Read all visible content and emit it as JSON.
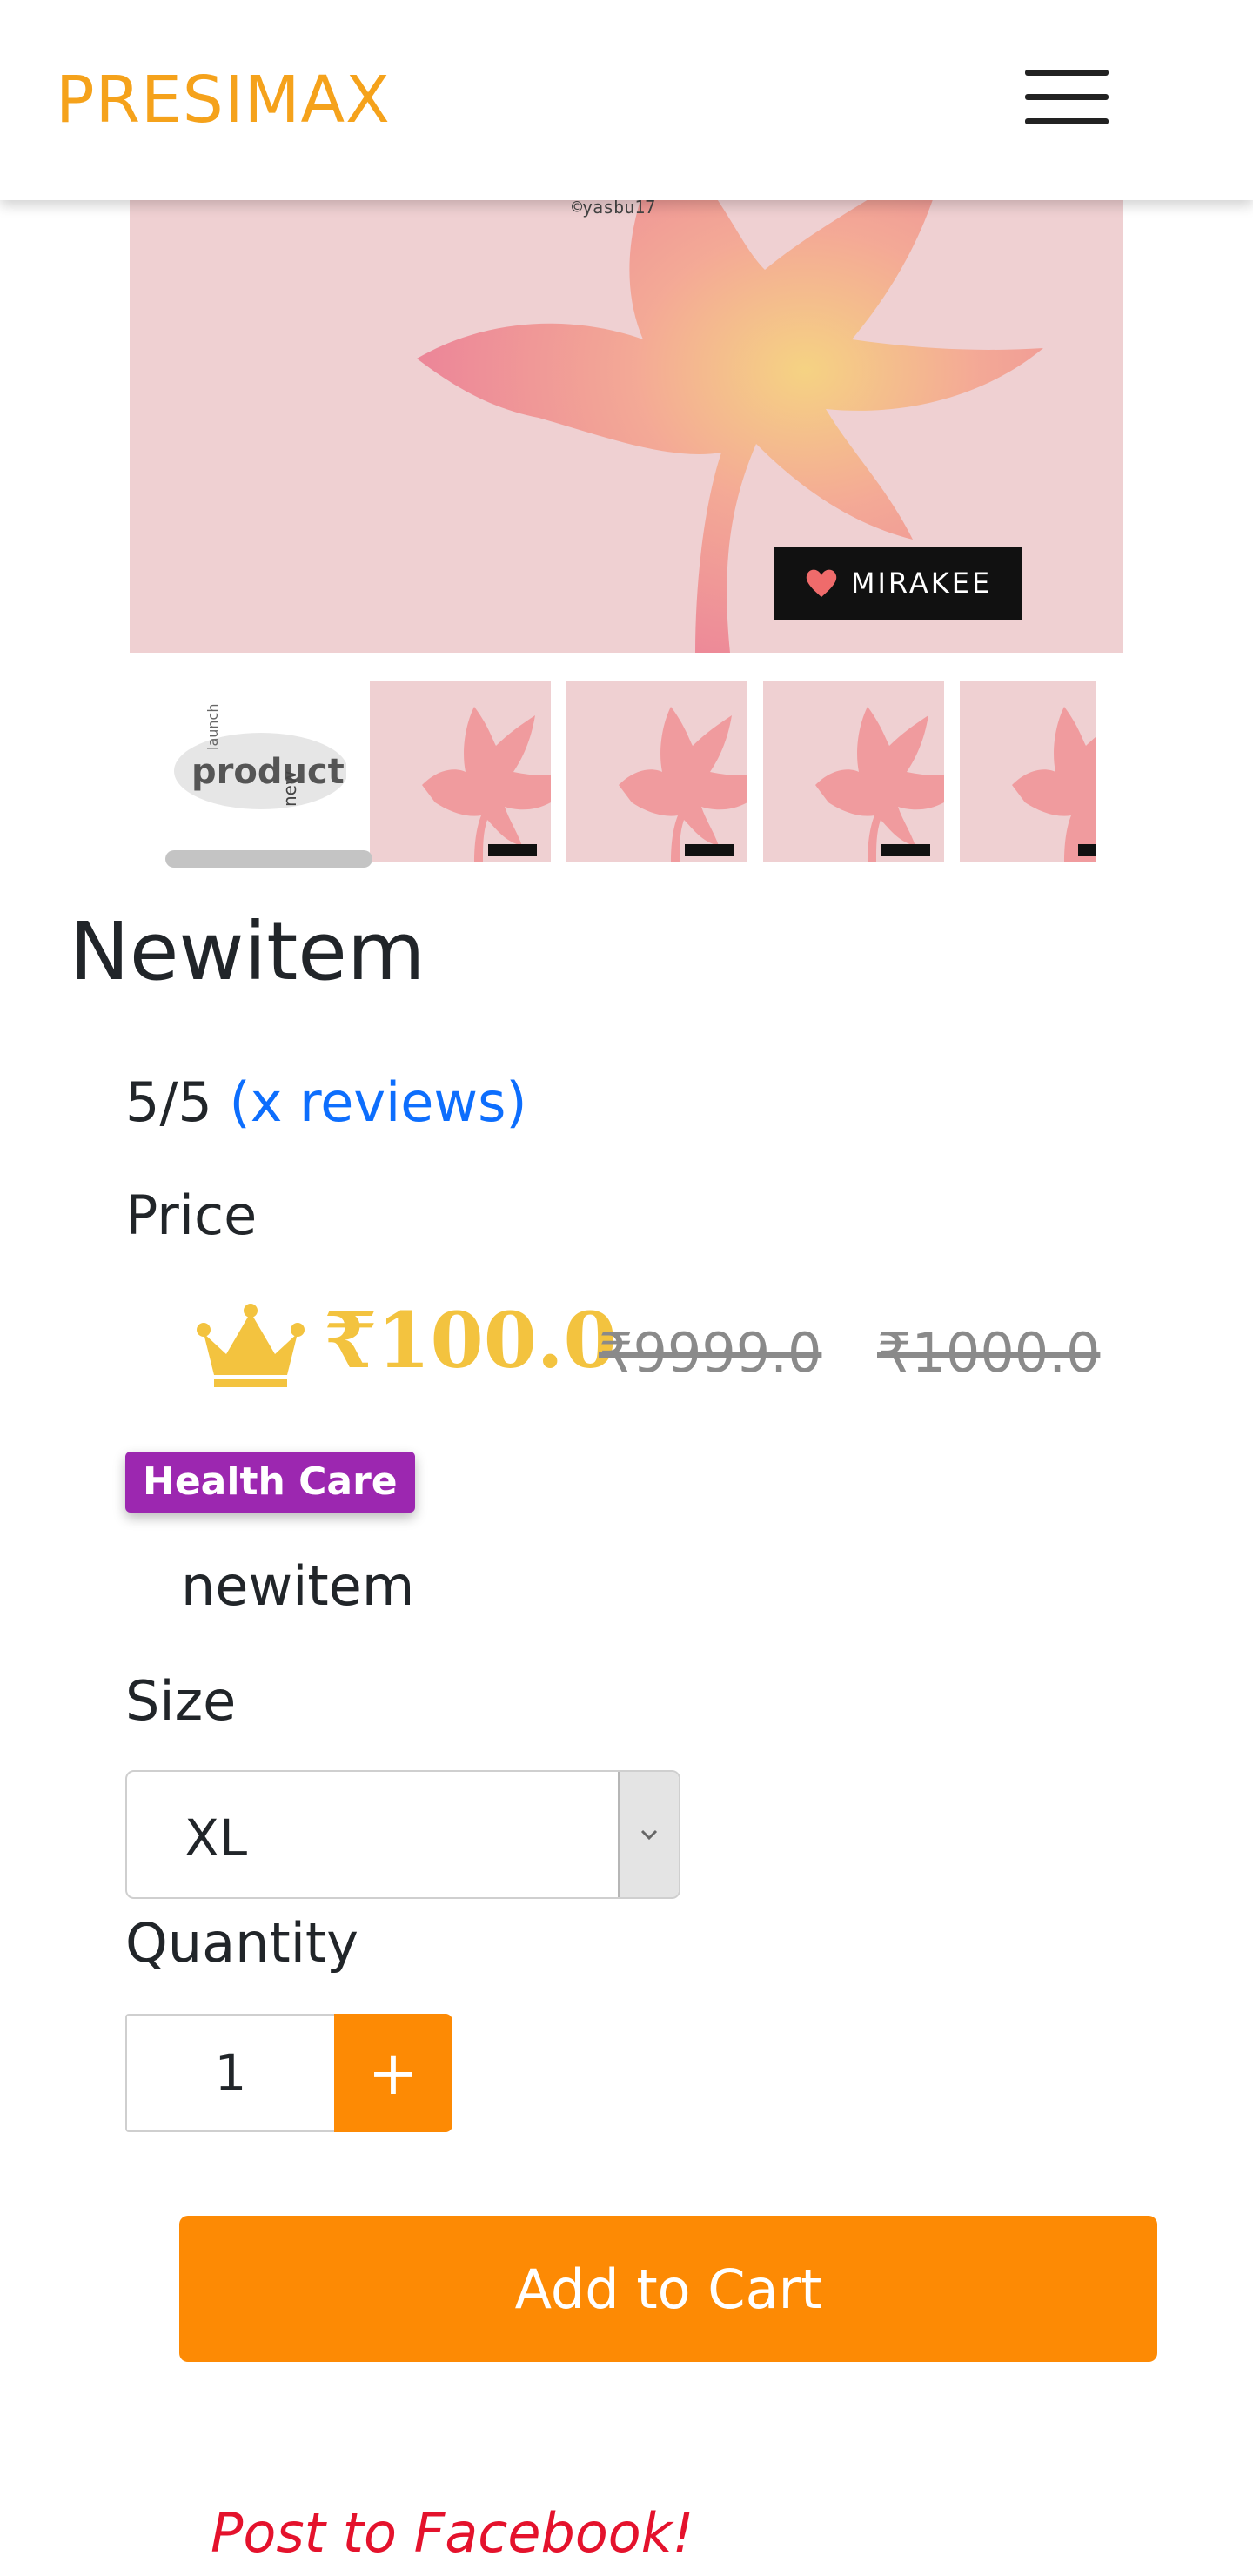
{
  "header": {
    "brand": "PRESIMAX",
    "menu_icon": "hamburger-menu-icon"
  },
  "gallery": {
    "main_image": {
      "watermark_handle": "©yasbu17",
      "badge_text": "MIRAKEE",
      "badge_icon": "heart-icon"
    },
    "thumbnail_1_words": [
      "product",
      "new",
      "launch"
    ],
    "thumbnail_count": 5,
    "thumbnail_scroll_position": 0
  },
  "product": {
    "title": "Newitem",
    "rating": "5/5",
    "reviews_link": "(x reviews)",
    "price_label": "Price",
    "price_icon": "crown-icon",
    "price": "₹100.0",
    "strikethrough_price_1": "₹9999.0",
    "strikethrough_price_2": "₹1000.0",
    "category_badge": "Health Care",
    "description": "newitem",
    "size_label": "Size",
    "size_selected": "XL",
    "quantity_label": "Quantity",
    "quantity_value": "1",
    "quantity_plus": "+",
    "add_to_cart": "Add to Cart",
    "share_link": "Post to Facebook!"
  },
  "colors": {
    "brand": "#f5a21b",
    "price_gold": "#f3c33f",
    "accent_orange": "#fd8a04",
    "badge_purple": "#9c27b0",
    "link_blue": "#0d6efd",
    "facebook_link_red": "#e4122c"
  }
}
